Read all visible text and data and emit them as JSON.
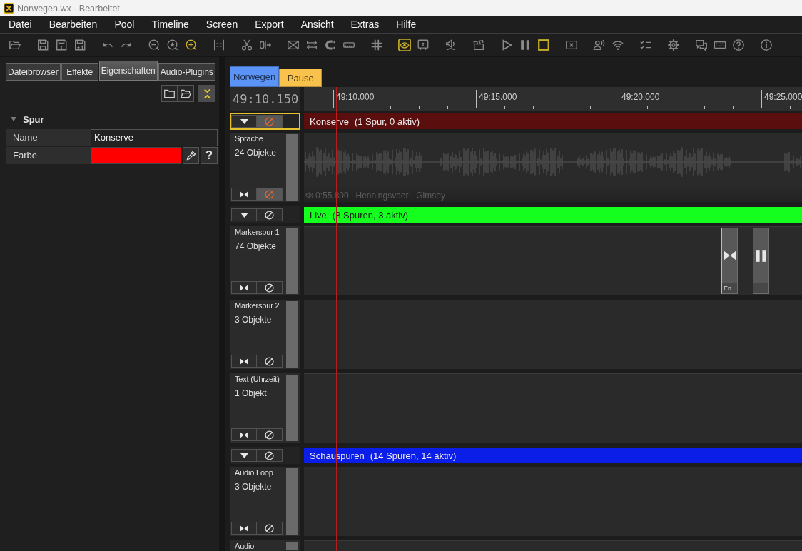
{
  "window": {
    "title": "Norwegen.wx - Bearbeitet"
  },
  "menu": [
    "Datei",
    "Bearbeiten",
    "Pool",
    "Timeline",
    "Screen",
    "Export",
    "Ansicht",
    "Extras",
    "Hilfe"
  ],
  "toolbar": [
    [
      {
        "active": false
      }
    ],
    [
      {
        "active": false
      },
      {
        "active": false
      },
      {
        "active": false
      }
    ],
    [
      {
        "active": false
      },
      {
        "active": false
      }
    ],
    [
      {
        "active": false
      },
      {
        "active": false
      },
      {
        "active": true
      }
    ],
    [
      {
        "active": false
      }
    ],
    [
      {
        "active": false
      },
      {
        "active": false
      }
    ],
    [
      {
        "active": false
      },
      {
        "active": false
      },
      {
        "active": false
      },
      {
        "active": false
      }
    ],
    [
      {
        "active": false
      }
    ],
    [
      {
        "active": true
      },
      {
        "active": false
      }
    ],
    [
      {
        "active": false
      }
    ],
    [
      {
        "active": false
      }
    ],
    [
      {
        "active": false
      },
      {
        "active": false
      },
      {
        "active": true
      }
    ],
    [
      {
        "active": false
      }
    ],
    [
      {
        "active": false
      },
      {
        "active": false
      }
    ],
    [
      {
        "active": false
      }
    ],
    [
      {
        "active": false
      }
    ],
    [
      {
        "active": false
      },
      {
        "active": false
      },
      {
        "active": false
      }
    ],
    [
      {
        "active": false
      }
    ]
  ],
  "side_panel": {
    "tabs": [
      {
        "label": "Dateibrowser",
        "selected": false
      },
      {
        "label": "Effekte",
        "selected": false
      },
      {
        "label": "Eigenschaften",
        "selected": true
      },
      {
        "label": "Audio-Plugins",
        "selected": false
      }
    ],
    "tools": [
      {
        "active": false
      },
      {
        "active": false
      },
      {
        "active": true
      }
    ],
    "section": {
      "title": "Spur",
      "expanded": true,
      "properties": [
        {
          "kind": "text",
          "label": "Name",
          "value": "Konserve"
        },
        {
          "kind": "color",
          "label": "Farbe",
          "color": "#ff0000",
          "help": "?"
        }
      ]
    }
  },
  "timeline": {
    "tabs": [
      {
        "label": "Norwegen",
        "color": "#5b93f7",
        "selected": true
      },
      {
        "label": "Pause",
        "color": "#f8c24c",
        "selected": false
      }
    ],
    "time": "49:10.150",
    "ruler": [
      "49:10.000",
      "49:15.000",
      "49:20.000",
      "49:25.000"
    ],
    "groups": [
      {
        "name": "Konserve",
        "summary": "(1 Spur, 0 aktiv)",
        "color": "#5a0e0e",
        "selected": true,
        "expanded": true,
        "disabled": true,
        "tracks": [
          {
            "name": "Sprache",
            "count": "24 Objekte",
            "disabled": true,
            "clip": {
              "kind": "audio",
              "info": "0:55.800 | Henningsvaer - Gimsoy"
            }
          }
        ]
      },
      {
        "name": "Live",
        "summary": "(3 Spuren, 3 aktiv)",
        "color": "#14ff1e",
        "selected": false,
        "expanded": true,
        "disabled": false,
        "tracks": [
          {
            "name": "Markerspur 1",
            "count": "74 Objekte",
            "disabled": false,
            "markers": [
              {
                "kind": "cue",
                "label": "En…"
              },
              {
                "kind": "pause"
              }
            ]
          },
          {
            "name": "Markerspur 2",
            "count": "3 Objekte",
            "disabled": false
          },
          {
            "name": "Text (Uhrzeit)",
            "count": "1 Objekt",
            "disabled": false
          }
        ]
      },
      {
        "name": "Schauspuren",
        "summary": "(14 Spuren, 14 aktiv)",
        "color": "#0a1ee8",
        "selected": false,
        "expanded": true,
        "disabled": false,
        "tracks": [
          {
            "name": "Audio Loop",
            "count": "3 Objekte",
            "disabled": false
          },
          {
            "name": "Audio"
          }
        ]
      }
    ]
  }
}
